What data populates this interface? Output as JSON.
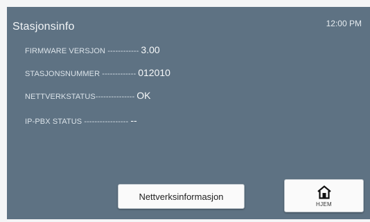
{
  "header": {
    "title": "Stasjonsinfo",
    "time": "12:00 PM"
  },
  "info_rows": [
    {
      "label": "FIRMWARE VERSJON ------------",
      "value": "3.00"
    },
    {
      "label": "STASJONSNUMMER -------------",
      "value": "012010"
    },
    {
      "label": "NETTVERKSTATUS---------------",
      "value": "OK"
    },
    {
      "label": "IP-PBX STATUS -----------------",
      "value": "--"
    }
  ],
  "buttons": {
    "network_info_label": "Nettverksinformasjon",
    "home_label": "HJEM",
    "home_icon": "house-icon"
  },
  "colors": {
    "screen_background": "#5e7283",
    "text": "#ffffff",
    "button_background": "#fafafa"
  }
}
